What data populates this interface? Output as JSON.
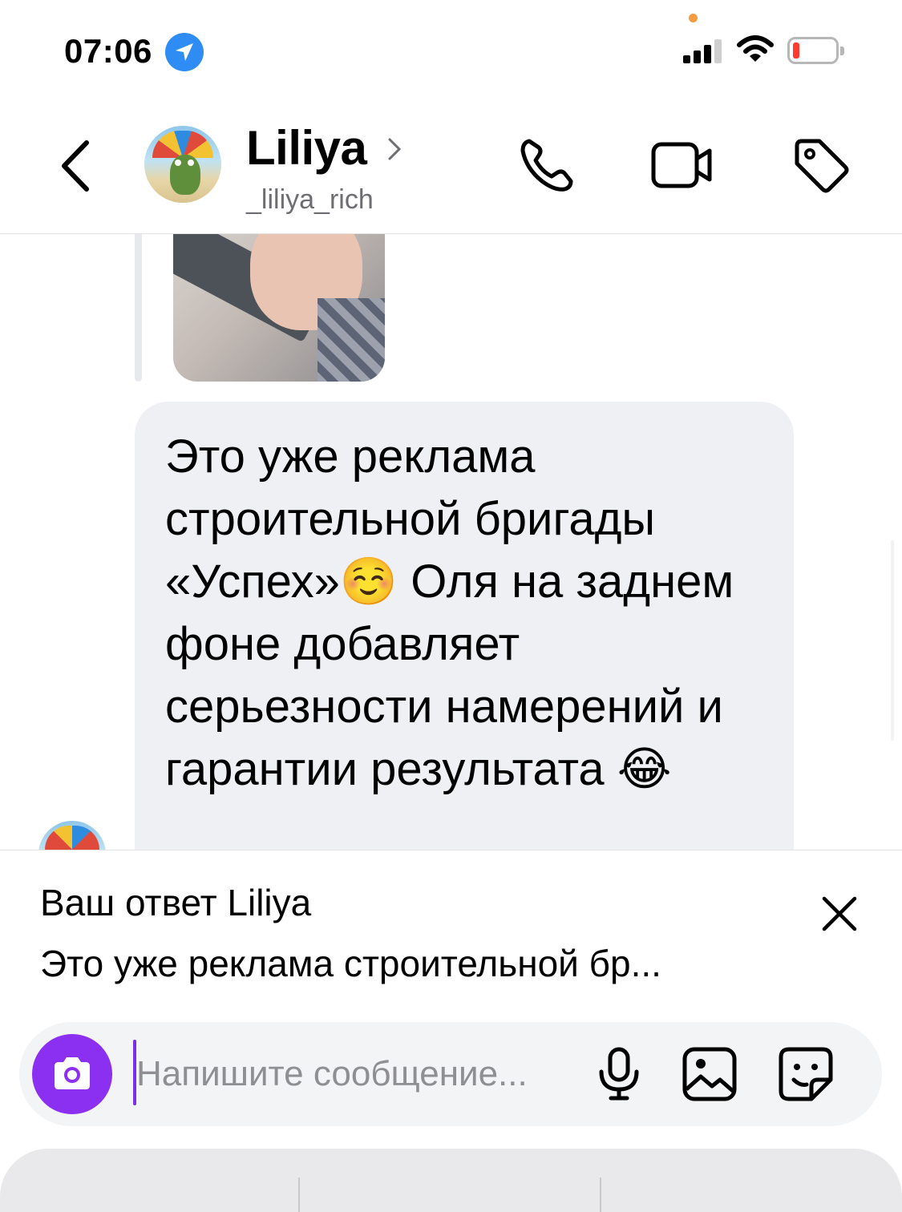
{
  "status_bar": {
    "time": "07:06",
    "accent_location": "#2f8cf5",
    "battery_color": "#ff3b30",
    "dot_color": "#f49d3f"
  },
  "header": {
    "contact_name": "Liliya",
    "contact_handle": "_liliya_rich",
    "icons": [
      "back-icon",
      "phone-icon",
      "video-icon",
      "tag-icon"
    ]
  },
  "messages": {
    "bubble_text": "Это уже реклама строительной бригады «Успех»☺️ Оля на заднем фоне добавляет серьезности намерений и гарантии результата 😂",
    "bubble_color": "#eff0f3"
  },
  "reply": {
    "title": "Ваш ответ Liliya",
    "preview": "Это уже реклама строительной бр..."
  },
  "composer": {
    "placeholder": "Напишите сообщение...",
    "accent": "#8b2ff0",
    "icons": [
      "camera-icon",
      "microphone-icon",
      "gallery-icon",
      "sticker-icon"
    ]
  }
}
